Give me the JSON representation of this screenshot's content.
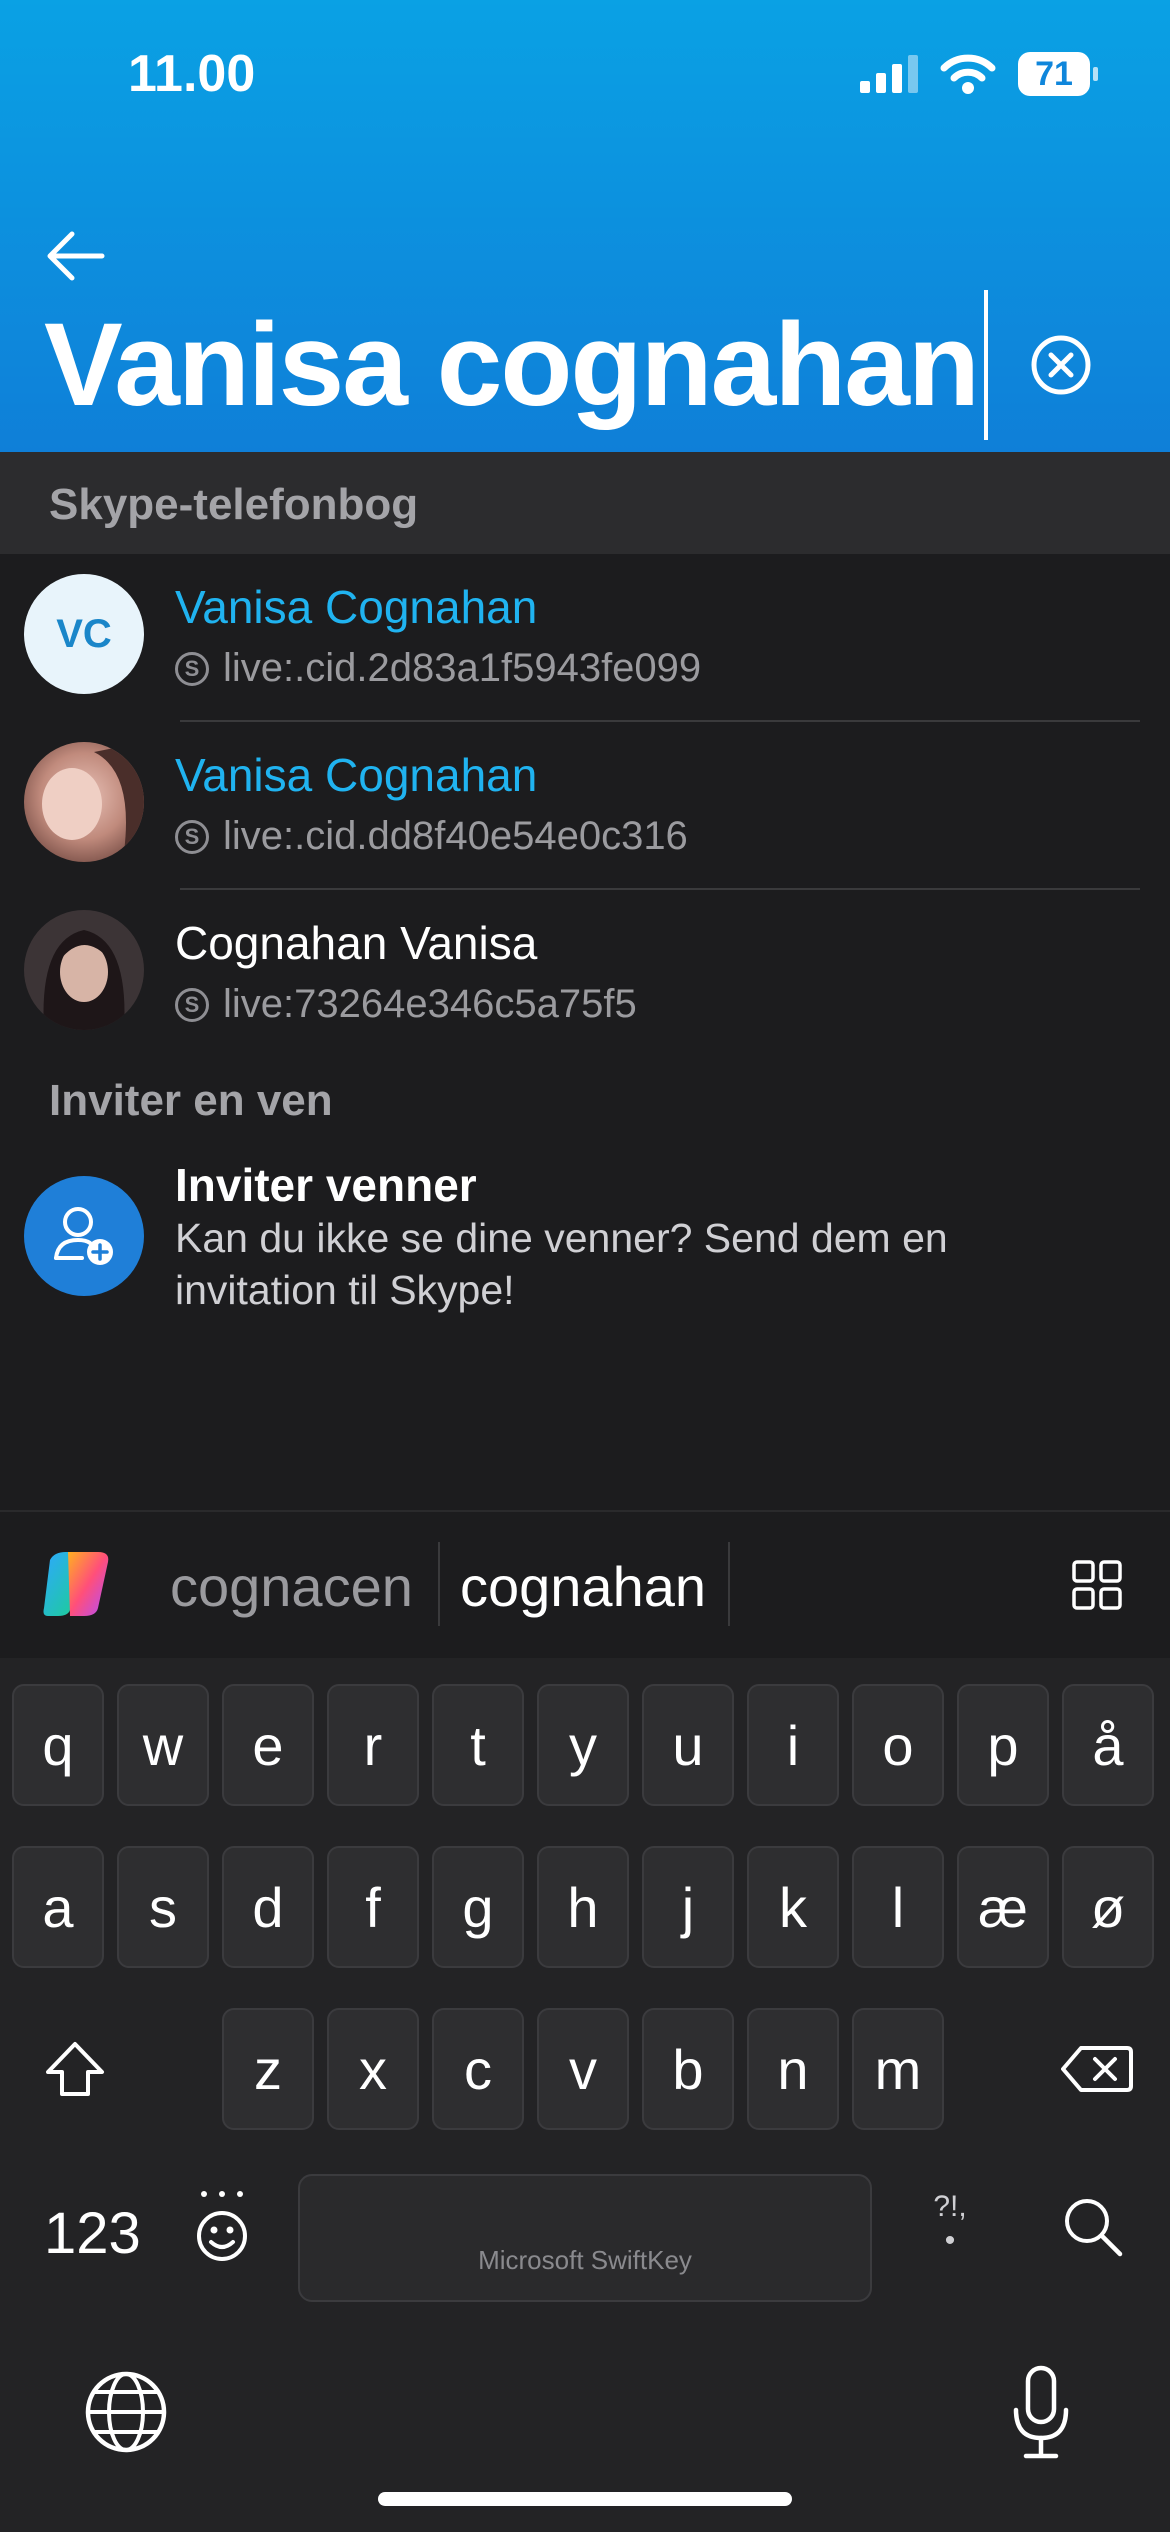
{
  "status_bar": {
    "time": "11.00",
    "battery": "71"
  },
  "search": {
    "query": "Vanisa cognahan"
  },
  "directory_section": {
    "title": "Skype-telefonbog"
  },
  "results": [
    {
      "name": "Vanisa Cognahan",
      "id": "live:.cid.2d83a1f5943fe099",
      "initials": "VC",
      "highlight": true
    },
    {
      "name": "Vanisa Cognahan",
      "id": "live:.cid.dd8f40e54e0c316",
      "initials": "",
      "highlight": true
    },
    {
      "name": "Cognahan Vanisa",
      "id": "live:73264e346c5a75f5",
      "initials": "",
      "highlight": false
    }
  ],
  "invite_section": {
    "title": "Inviter en ven",
    "item_title": "Inviter venner",
    "item_text": "Kan du ikke se dine venner? Send dem en invitation til Skype!"
  },
  "keyboard": {
    "suggestions": [
      "cognacen",
      "cognahan"
    ],
    "row1": [
      "q",
      "w",
      "e",
      "r",
      "t",
      "y",
      "u",
      "i",
      "o",
      "p",
      "å"
    ],
    "row2": [
      "a",
      "s",
      "d",
      "f",
      "g",
      "h",
      "j",
      "k",
      "l",
      "æ",
      "ø"
    ],
    "row3": [
      "z",
      "x",
      "c",
      "v",
      "b",
      "n",
      "m"
    ],
    "numbers_key": "123",
    "space_label": "Microsoft SwiftKey",
    "punct_key": "?!,",
    "icons": [
      "copilot-icon",
      "grid-icon",
      "shift-icon",
      "backspace-icon",
      "emoji-icon",
      "search-icon",
      "globe-icon",
      "microphone-icon"
    ]
  }
}
